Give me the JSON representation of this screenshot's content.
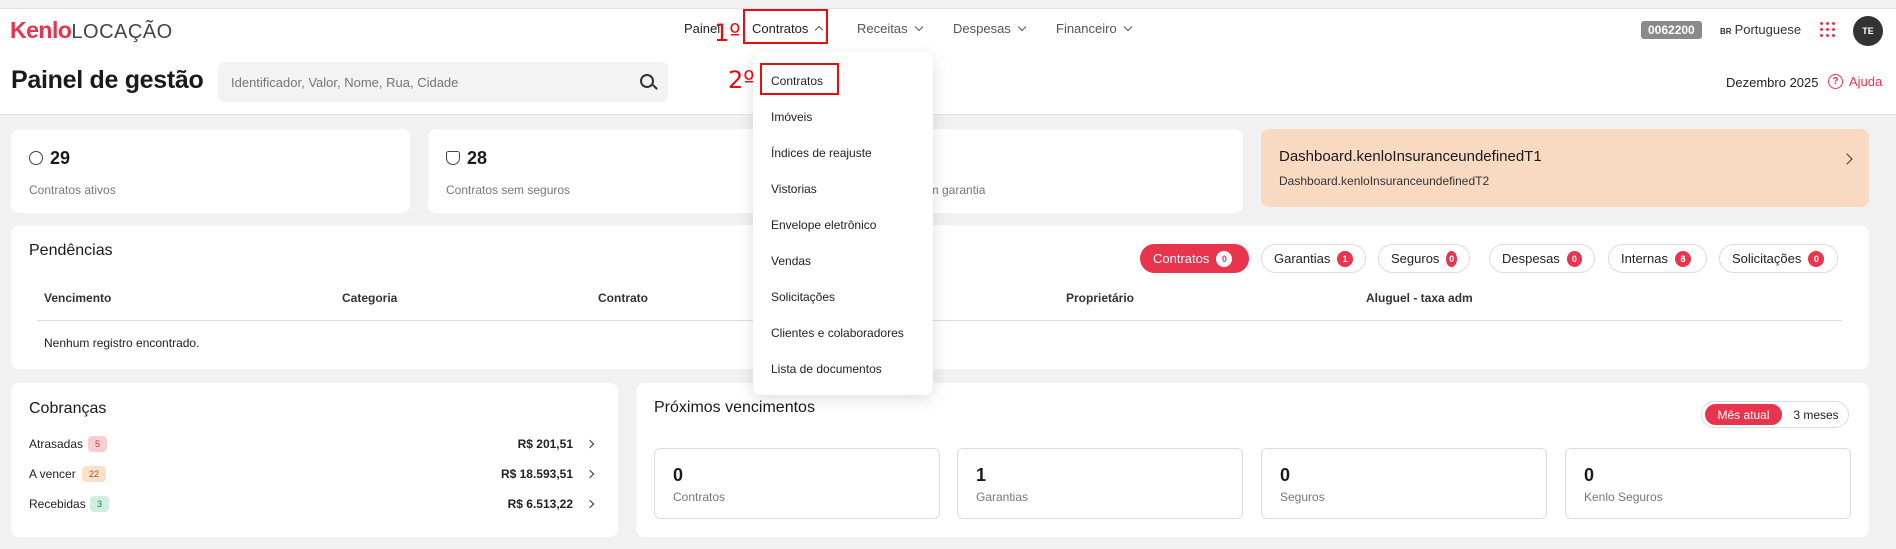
{
  "nav": {
    "logo_brand": "Kenlo",
    "logo_product": "LOCAÇÃO",
    "items": [
      {
        "label": "Painel"
      },
      {
        "label": "Contratos"
      },
      {
        "label": "Receitas"
      },
      {
        "label": "Despesas"
      },
      {
        "label": "Financeiro"
      }
    ],
    "step1": "1º",
    "step2": "2º",
    "code": "0062200",
    "lang_flag": "BR",
    "lang": "Portuguese",
    "avatar": "TE"
  },
  "header": {
    "title": "Painel de gestão",
    "search_placeholder": "Identificador, Valor, Nome, Rua, Cidade",
    "month": "Dezembro 2025",
    "help": "Ajuda"
  },
  "stats": [
    {
      "value": "29",
      "label": "Contratos ativos",
      "icon": "check-circle-icon"
    },
    {
      "value": "28",
      "label": "Contratos sem seguros",
      "icon": "shield-icon"
    },
    {
      "label_partial": "em garantia"
    }
  ],
  "insurance": {
    "t1": "Dashboard.kenloInsuranceundefinedT1",
    "t2": "Dashboard.kenloInsuranceundefinedT2"
  },
  "pendencias": {
    "title": "Pendências",
    "chips": [
      {
        "label": "Contratos",
        "count": "0"
      },
      {
        "label": "Garantias",
        "count": "1"
      },
      {
        "label": "Seguros",
        "count": "0"
      },
      {
        "label": "Despesas",
        "count": "0"
      },
      {
        "label": "Internas",
        "count": "8"
      },
      {
        "label": "Solicitações",
        "count": "0"
      }
    ],
    "columns": [
      "Vencimento",
      "Categoria",
      "Contrato",
      "Proprietário",
      "Aluguel - taxa adm"
    ],
    "empty": "Nenhum registro encontrado."
  },
  "cobrancas": {
    "title": "Cobranças",
    "rows": [
      {
        "label": "Atrasadas",
        "badge": "5",
        "value": "R$ 201,51"
      },
      {
        "label": "A vencer",
        "badge": "22",
        "value": "R$ 18.593,51"
      },
      {
        "label": "Recebidas",
        "badge": "3",
        "value": "R$ 6.513,22"
      }
    ]
  },
  "proximos": {
    "title": "Próximos vencimentos",
    "toggle_on": "Mês atual",
    "toggle_off": "3 meses",
    "cards": [
      {
        "value": "0",
        "label": "Contratos"
      },
      {
        "value": "1",
        "label": "Garantias"
      },
      {
        "value": "0",
        "label": "Seguros"
      },
      {
        "value": "0",
        "label": "Kenlo Seguros"
      }
    ]
  },
  "dropdown": {
    "items": [
      "Contratos",
      "Imóveis",
      "Índices de reajuste",
      "Vistorias",
      "Envelope eletrônico",
      "Vendas",
      "Solicitações",
      "Clientes e colaboradores",
      "Lista de documentos"
    ]
  },
  "colors": {
    "accent": "#e8344d",
    "annotation": "#e01010",
    "insurance_bg": "#f8d9c2"
  }
}
